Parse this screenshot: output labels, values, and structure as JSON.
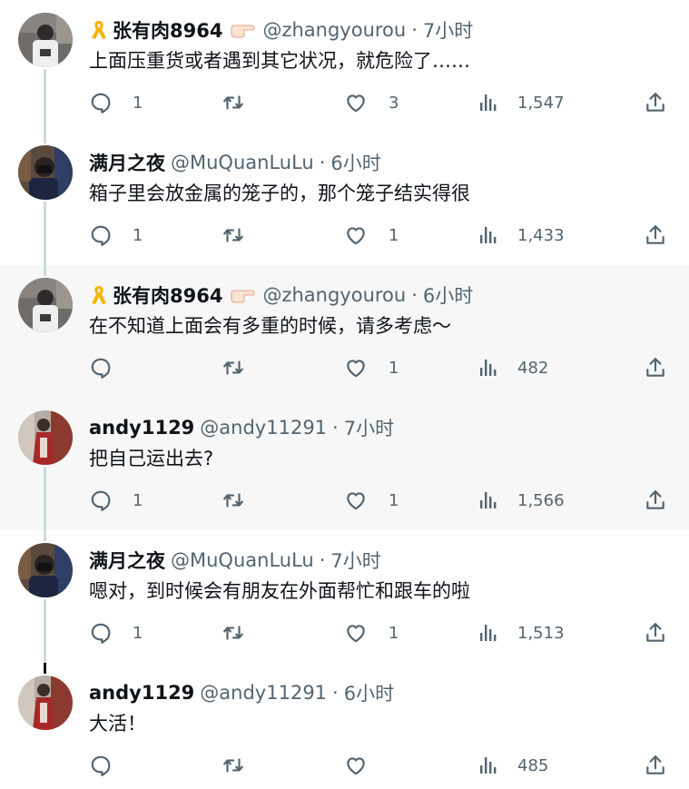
{
  "colors": {
    "text": "#0f1419",
    "secondary": "#536471",
    "thread_line": "#cfd9de",
    "highlight_bg": "#f7f7f7",
    "ribbon": "#f4b400"
  },
  "icons": {
    "reply": "reply-icon",
    "retweet": "retweet-icon",
    "like": "like-icon",
    "views": "views-icon",
    "share": "share-icon",
    "ribbon": "yellow-ribbon-icon",
    "hand": "pointing-hand-emoji"
  },
  "tweets": [
    {
      "name": "张有肉8964",
      "handle": "@zhangyourou",
      "sep": "·",
      "time": "7小时",
      "text": "上面压重货或者遇到其它状况，就危险了……",
      "replies": "1",
      "retweets": "",
      "likes": "3",
      "views": "1,547",
      "has_ribbon": true
    },
    {
      "name": "满月之夜",
      "handle": "@MuQuanLuLu",
      "sep": "·",
      "time": "6小时",
      "text": "箱子里会放金属的笼子的，那个笼子结实得很",
      "replies": "1",
      "retweets": "",
      "likes": "1",
      "views": "1,433",
      "has_ribbon": false
    },
    {
      "name": "张有肉8964",
      "handle": "@zhangyourou",
      "sep": "·",
      "time": "6小时",
      "text": "在不知道上面会有多重的时候，请多考虑～",
      "replies": "",
      "retweets": "",
      "likes": "1",
      "views": "482",
      "has_ribbon": true
    },
    {
      "name": "andy1129",
      "handle": "@andy11291",
      "sep": "·",
      "time": "7小时",
      "text": "把自己运出去?",
      "replies": "1",
      "retweets": "",
      "likes": "1",
      "views": "1,566",
      "has_ribbon": false
    },
    {
      "name": "满月之夜",
      "handle": "@MuQuanLuLu",
      "sep": "·",
      "time": "7小时",
      "text": "嗯对，到时候会有朋友在外面帮忙和跟车的啦",
      "replies": "1",
      "retweets": "",
      "likes": "1",
      "views": "1,513",
      "has_ribbon": false
    },
    {
      "name": "andy1129",
      "handle": "@andy11291",
      "sep": "·",
      "time": "6小时",
      "text": "大活！",
      "replies": "",
      "retweets": "",
      "likes": "",
      "views": "485",
      "has_ribbon": false
    }
  ]
}
